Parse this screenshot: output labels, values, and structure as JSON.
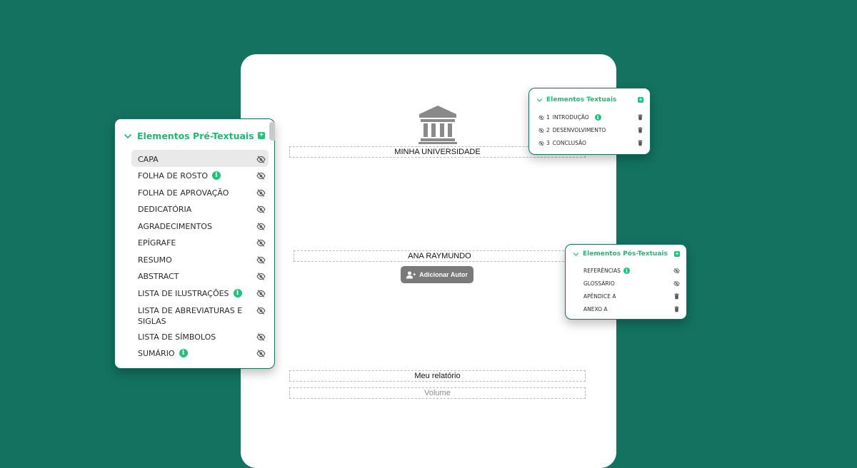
{
  "document": {
    "university": "MINHA UNIVERSIDADE",
    "author": "ANA RAYMUNDO",
    "add_author_label": "Adicionar Autor",
    "title": "Meu relatório",
    "volume_placeholder": "Volume"
  },
  "pre_textual": {
    "title": "Elementos Pré-Textuais",
    "items": [
      {
        "label": "CAPA",
        "info": false,
        "selected": true
      },
      {
        "label": "FOLHA DE ROSTO",
        "info": true
      },
      {
        "label": "FOLHA DE APROVAÇÃO",
        "info": false
      },
      {
        "label": "DEDICATÓRIA",
        "info": false
      },
      {
        "label": "AGRADECIMENTOS",
        "info": false
      },
      {
        "label": "EPÍGRAFE",
        "info": false
      },
      {
        "label": "RESUMO",
        "info": false
      },
      {
        "label": "ABSTRACT",
        "info": false
      },
      {
        "label": "LISTA DE ILUSTRAÇÕES",
        "info": true
      },
      {
        "label": "LISTA DE ABREVIATURAS E SIGLAS",
        "info": false
      },
      {
        "label": "LISTA DE SÍMBOLOS",
        "info": false
      },
      {
        "label": "SUMÁRIO",
        "info": true
      }
    ]
  },
  "textual": {
    "title": "Elementos Textuais",
    "items": [
      {
        "number": "1",
        "label": "INTRODUÇÃO",
        "info": true
      },
      {
        "number": "2",
        "label": "DESENVOLVIMENTO",
        "info": false
      },
      {
        "number": "3",
        "label": "CONCLUSÃO",
        "info": false
      }
    ]
  },
  "post_textual": {
    "title": "Elementos Pós-Textuais",
    "items": [
      {
        "label": "REFERÊNCIAS",
        "info": true,
        "action": "eye-off-icon"
      },
      {
        "label": "GLOSSÁRIO",
        "info": false,
        "action": "eye-off-icon"
      },
      {
        "label": "APÊNDICE A",
        "info": false,
        "action": "trash-icon"
      },
      {
        "label": "ANEXO A",
        "info": false,
        "action": "trash-icon"
      }
    ]
  },
  "icons": {
    "info_glyph": "i",
    "plus_glyph": "+",
    "chevron": "chevron-down-icon",
    "university": "university-building-icon"
  },
  "colors": {
    "background": "#137260",
    "accent": "#1fc37a",
    "button": "#7a7a7a"
  }
}
